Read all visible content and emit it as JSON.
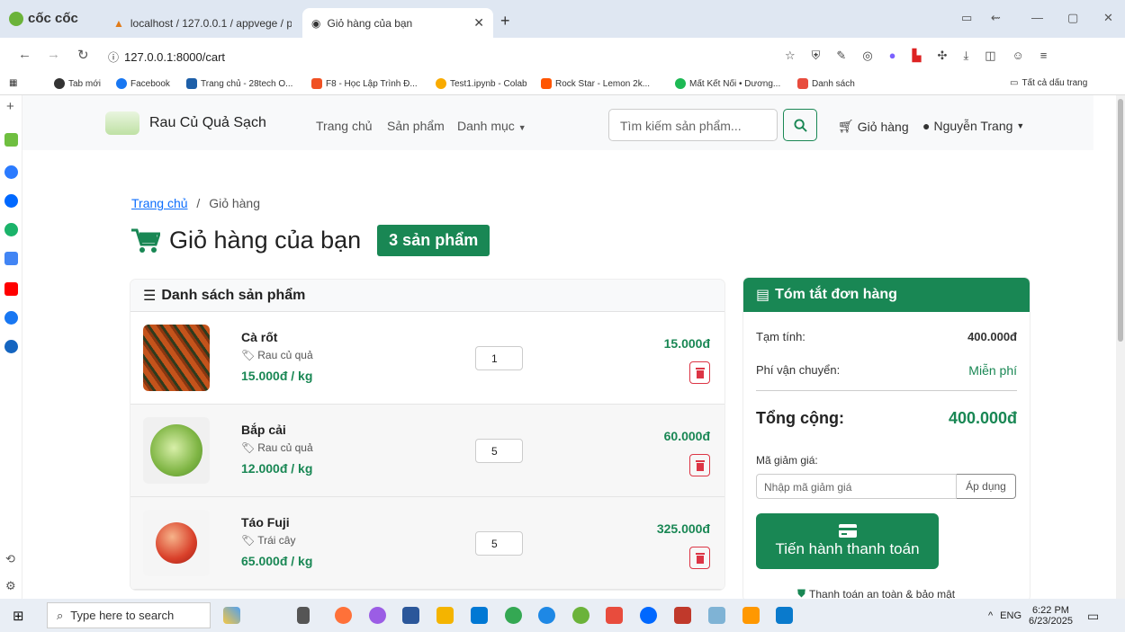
{
  "browser": {
    "brand": "cốc cốc",
    "tabs": [
      {
        "label": "localhost / 127.0.0.1 / appvege / p"
      },
      {
        "label": "Giỏ hàng của bạn"
      }
    ],
    "url": "127.0.0.1:8000/cart",
    "bookmarks": [
      "Tab mới",
      "Facebook",
      "Trang chủ - 28tech O...",
      "F8 - Học Lập Trình Đ...",
      "Test1.ipynb - Colab",
      "Rock Star - Lemon 2k...",
      "Mất Kết Nối • Dương...",
      "Danh sách",
      "Tất cả dấu trang"
    ]
  },
  "navbar": {
    "site_title": "Rau Củ Quả Sạch",
    "links": [
      "Trang chủ",
      "Sản phẩm",
      "Danh mục"
    ],
    "search_placeholder": "Tìm kiếm sản phẩm...",
    "cart_label": "Giỏ hàng",
    "user_label": "Nguyễn Trang"
  },
  "breadcrumb": {
    "home": "Trang chủ",
    "separator": "/",
    "current": "Giỏ hàng"
  },
  "heading": {
    "title": "Giỏ hàng của bạn",
    "badge": "3 sản phẩm"
  },
  "cart": {
    "header": "Danh sách sản phẩm",
    "items": [
      {
        "name": "Cà rốt",
        "category": "Rau củ quả",
        "price": "15.000đ / kg",
        "qty": "1",
        "total": "15.000đ"
      },
      {
        "name": "Bắp cải",
        "category": "Rau củ quả",
        "price": "12.000đ / kg",
        "qty": "5",
        "total": "60.000đ"
      },
      {
        "name": "Táo Fuji",
        "category": "Trái cây",
        "price": "65.000đ / kg",
        "qty": "5",
        "total": "325.000đ"
      }
    ]
  },
  "summary": {
    "header": "Tóm tắt đơn hàng",
    "subtotal_label": "Tạm tính:",
    "subtotal": "400.000đ",
    "shipping_label": "Phí vận chuyển:",
    "shipping": "Miễn phí",
    "total_label": "Tổng cộng:",
    "total": "400.000đ",
    "coupon_label": "Mã giảm giá:",
    "coupon_placeholder": "Nhập mã giảm giá",
    "coupon_button": "Áp dụng",
    "checkout": "Tiến hành thanh toán",
    "secure": "Thanh toán an toàn & bảo mật"
  },
  "taskbar": {
    "search": "Type here to search",
    "lang": "ENG",
    "time": "6:22 PM",
    "date": "6/23/2025"
  },
  "colors": {
    "primary": "#198754",
    "danger": "#dc3545",
    "link": "#0d6efd"
  }
}
